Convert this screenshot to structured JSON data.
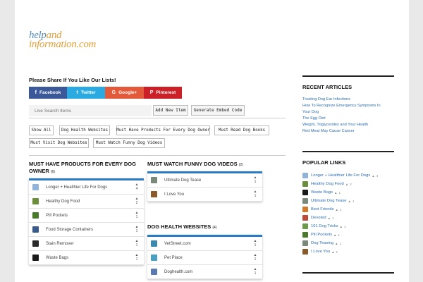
{
  "logo": {
    "line1_a": "help",
    "line1_b": "and",
    "line2": "information.com"
  },
  "share": {
    "title": "Please Share If You Like Our Lists!",
    "buttons": [
      {
        "icon": "f",
        "label": "Facebook",
        "color": "#3b5998"
      },
      {
        "icon": "t",
        "label": "Twitter",
        "color": "#2ba9e1"
      },
      {
        "icon": "G",
        "label": "Google+",
        "color": "#e25a3a"
      },
      {
        "icon": "P",
        "label": "Pinterest",
        "color": "#cb2027"
      }
    ]
  },
  "search": {
    "placeholder": "Live Search Items",
    "add_label": "Add New Item",
    "embed_label": "Generate Embed Code"
  },
  "filters": [
    "Show All",
    "Dog Health Websites",
    "Must Have Products For Every Dog Owner",
    "Must Read Dog Books",
    "Must Visit Dog Websites",
    "Must Watch Funny Dog Videos"
  ],
  "lists": {
    "products": {
      "title": "MUST HAVE PRODUCTS FOR EVERY DOG OWNER",
      "count": "(6)",
      "items": [
        {
          "label": "Longer + Healthier Life For Dogs",
          "votes": "4",
          "color": "#8fb3d9"
        },
        {
          "label": "Healthy Dog Food",
          "votes": "2",
          "color": "#6b8e3a"
        },
        {
          "label": "Pill Pockets",
          "votes": "1",
          "color": "#4a7a2c"
        },
        {
          "label": "Food Storage Containers",
          "votes": "1",
          "color": "#3a5a8a"
        },
        {
          "label": "Stain Remover",
          "votes": "1",
          "color": "#2a2a2a"
        },
        {
          "label": "Waste Bags",
          "votes": "1",
          "color": "#1a1a1a"
        }
      ]
    },
    "videos": {
      "title": "MUST WATCH FUNNY DOG VIDEOS",
      "count": "(2)",
      "items": [
        {
          "label": "Ultimate Dog Tease",
          "votes": "1",
          "color": "#7a8a7a"
        },
        {
          "label": "I Love You",
          "votes": "1",
          "color": "#8a5a2a"
        }
      ]
    },
    "health": {
      "title": "DOG HEALTH WEBSITES",
      "count": "(4)",
      "items": [
        {
          "label": "VetStreet.com",
          "votes": "1",
          "color": "#3a8ab0"
        },
        {
          "label": "Pet Place",
          "votes": "1",
          "color": "#4aa0c0"
        },
        {
          "label": "Doghealth.com",
          "votes": "1",
          "color": "#5a7ab0"
        }
      ]
    }
  },
  "sidebar": {
    "recent_title": "RECENT ARTICLES",
    "recent": [
      "Treating Dog Ear Infections",
      "How To Recognize Emergency Symptoms In",
      "Your Dog",
      "The Egg Diet",
      "Weight, Triglycerides and Your Health",
      "Red Meat May Cause Cancer"
    ],
    "popular_title": "POPULAR LINKS",
    "popular": [
      {
        "label": "Longer + Healthier Life For Dogs",
        "count": "4",
        "color": "#8fb3d9"
      },
      {
        "label": "Healthy Dog Food",
        "count": "2",
        "color": "#6b8e3a"
      },
      {
        "label": "Waste Bags",
        "count": "1",
        "color": "#1a1a1a"
      },
      {
        "label": "Ultimate Dog Tease",
        "count": "1",
        "color": "#7a8a7a"
      },
      {
        "label": "Best Friends",
        "count": "1",
        "color": "#d07a2a"
      },
      {
        "label": "Devoted",
        "count": "1",
        "color": "#c04a3a"
      },
      {
        "label": "101 Dog Tricks",
        "count": "1",
        "color": "#6a9a4a"
      },
      {
        "label": "Pill Pockets",
        "count": "1",
        "color": "#4a7a2c"
      },
      {
        "label": "Dog Teasing",
        "count": "1",
        "color": "#7a8a7a"
      },
      {
        "label": "I Love You",
        "count": "1",
        "color": "#8a5a2a"
      }
    ]
  },
  "icons": {
    "thumbs_up": "thumbs-up-icon"
  }
}
